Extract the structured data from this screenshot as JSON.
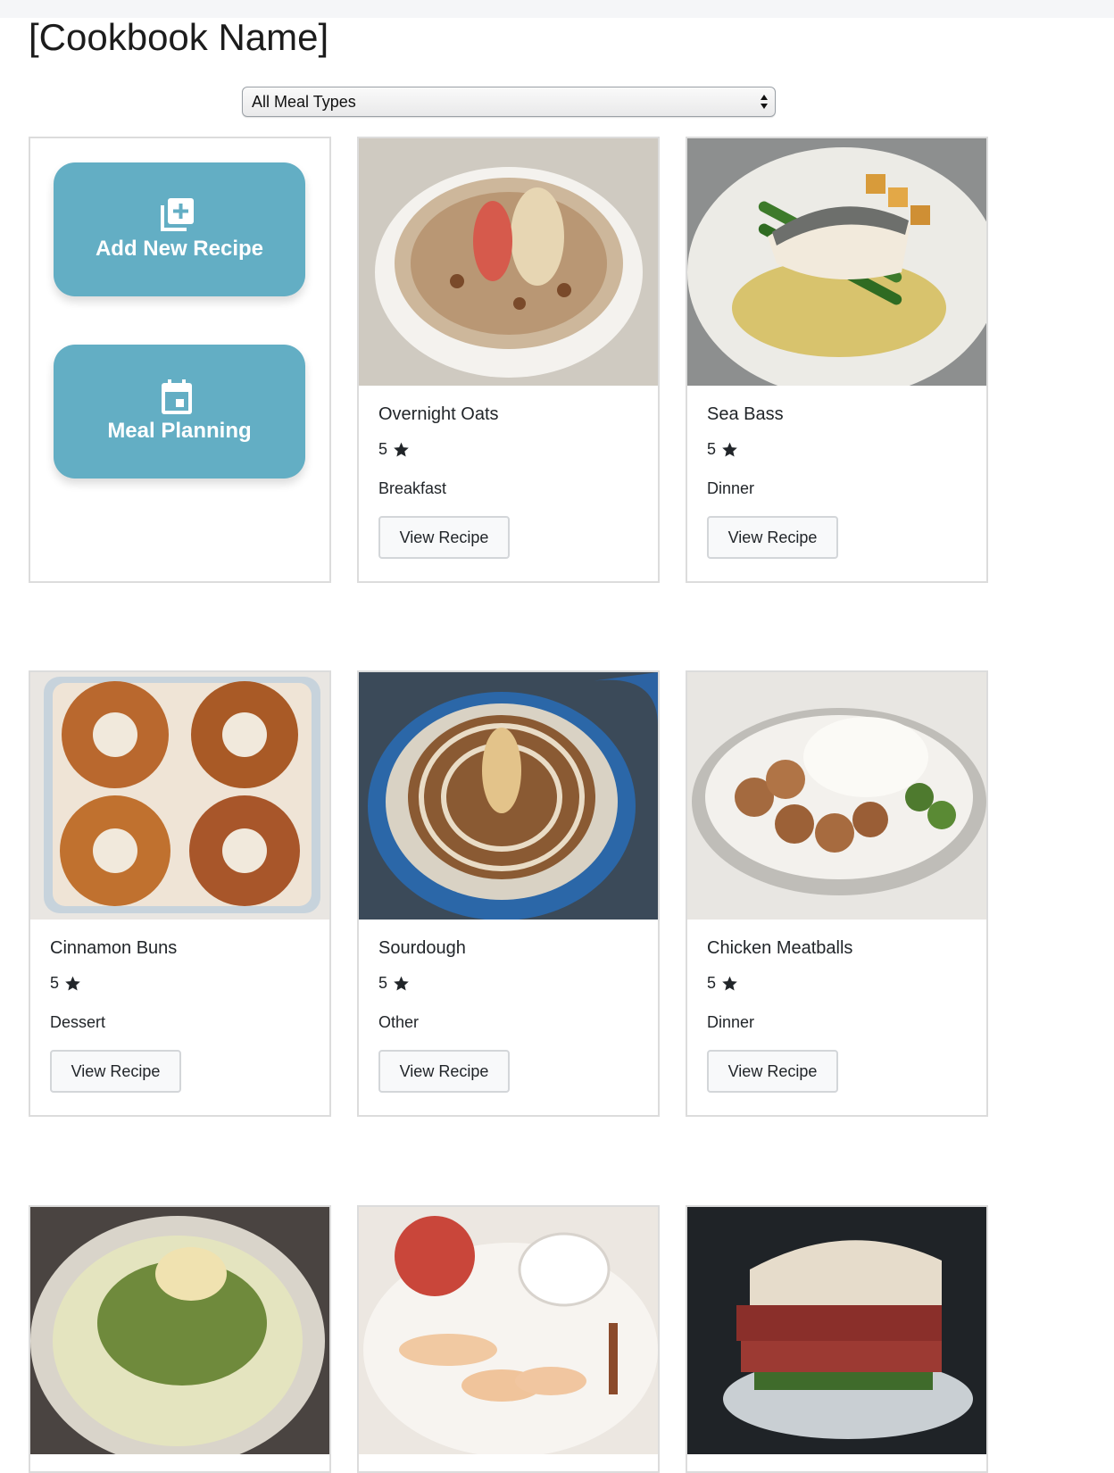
{
  "header": {
    "title": "[Cookbook Name]"
  },
  "filter": {
    "selected": "All Meal Types"
  },
  "actions": {
    "add_recipe_label": "Add New Recipe",
    "meal_planning_label": "Meal Planning",
    "add_icon": "library-add-icon",
    "calendar_icon": "calendar-event-icon"
  },
  "colors": {
    "action_button": "#63aec4",
    "card_border": "#dcdcdc"
  },
  "recipes": [
    {
      "name": "Overnight Oats",
      "rating": "5",
      "type": "Breakfast",
      "button": "View Recipe"
    },
    {
      "name": "Sea Bass",
      "rating": "5",
      "type": "Dinner",
      "button": "View Recipe"
    },
    {
      "name": "Cinnamon Buns",
      "rating": "5",
      "type": "Dessert",
      "button": "View Recipe"
    },
    {
      "name": "Sourdough",
      "rating": "5",
      "type": "Other",
      "button": "View Recipe"
    },
    {
      "name": "Chicken Meatballs",
      "rating": "5",
      "type": "Dinner",
      "button": "View Recipe"
    }
  ]
}
